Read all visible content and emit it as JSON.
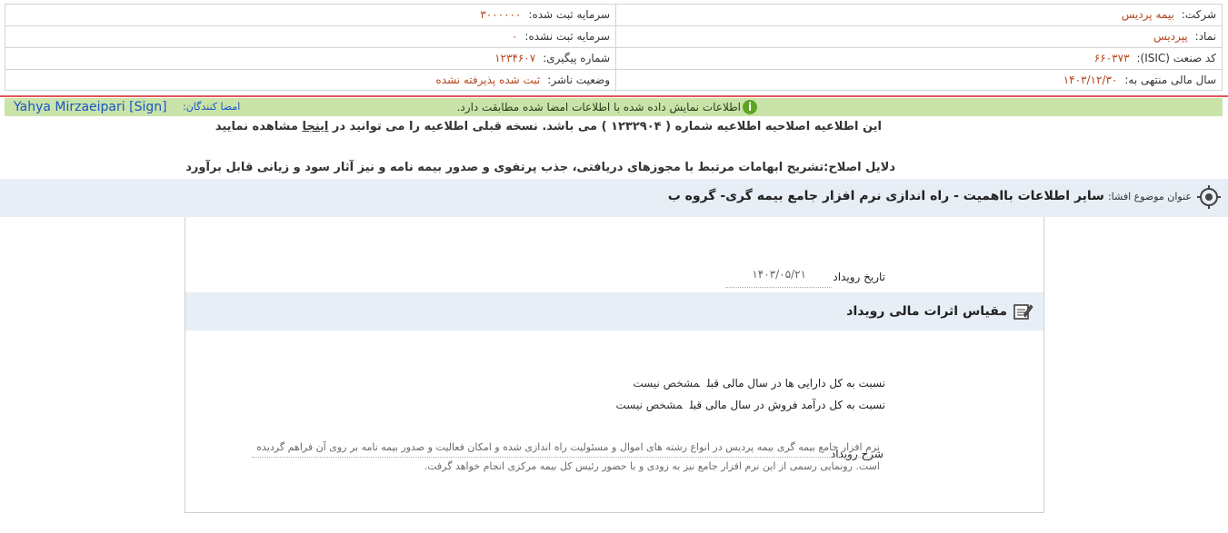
{
  "company_info": {
    "rows": [
      {
        "right_label": "شرکت:",
        "right_value": "بیمه پردیس",
        "left_label": "سرمایه ثبت شده:",
        "left_value": "۳۰۰۰۰۰۰"
      },
      {
        "right_label": "نماد:",
        "right_value": "پپردیس",
        "left_label": "سرمایه ثبت نشده:",
        "left_value": "۰"
      },
      {
        "right_label": "کد صنعت (ISIC):",
        "right_value": "۶۶۰۳۷۳",
        "left_label": "شماره پیگیری:",
        "left_value": "۱۲۳۴۶۰۷"
      },
      {
        "right_label": "سال مالی منتهی به:",
        "right_value": "۱۴۰۳/۱۲/۳۰",
        "left_label": "وضعیت ناشر:",
        "left_value": "ثبت شده پذیرفته نشده"
      }
    ]
  },
  "signature": {
    "label": "امضا کنندگان:",
    "name": "Yahya Mirzaeipari [Sign]",
    "message": "اطلاعات نمایش داده شده با اطلاعات امضا شده مطابقت دارد."
  },
  "notices": {
    "correction_text": "این اطلاعیه اصلاحیه اطلاعیه شماره ( ۱۲۳۲۹۰۴ ) می باشد. نسخه قبلی اطلاعیه را می توانید در",
    "correction_link": "اینجا",
    "correction_suffix": "مشاهده نمایید",
    "reason": "دلایل اصلاح:تشریح ابهامات مرتبط با مجوزهای دریافتی، جذب پرتفوی و صدور بیمه نامه و نیز آثار سود و زیانی قابل برآورد"
  },
  "subject": {
    "label": "عنوان موضوع افشا:",
    "title": "سایر اطلاعات بااهمیت - راه اندازی نرم افزار جامع بیمه گری- گروه ب"
  },
  "event": {
    "date_label": "تاریخ رویداد",
    "date_value": "۱۴۰۳/۰۵/۲۱",
    "section_title": "مقیاس اثرات مالی رویداد",
    "metrics": [
      {
        "label": "نسبت به کل دارایی ها در سال مالی قبل",
        "value": "مشخص نیست"
      },
      {
        "label": "نسبت به کل درآمد فروش در سال مالی قبل",
        "value": "مشخص نیست"
      }
    ],
    "desc_label": "شرح رویداد",
    "description": "نرم افزار جامع بیمه گری بیمه پردیس در انواع رشته های اموال و مسئولیت راه اندازی شده و امکان فعالیت و صدور بیمه نامه بر روی آن فراهم گردیده است. رونمایی رسمی از این نرم افزار جامع نیز به زودی و با حضور رئیس کل بیمه مرکزی انجام خواهد گرفت."
  }
}
